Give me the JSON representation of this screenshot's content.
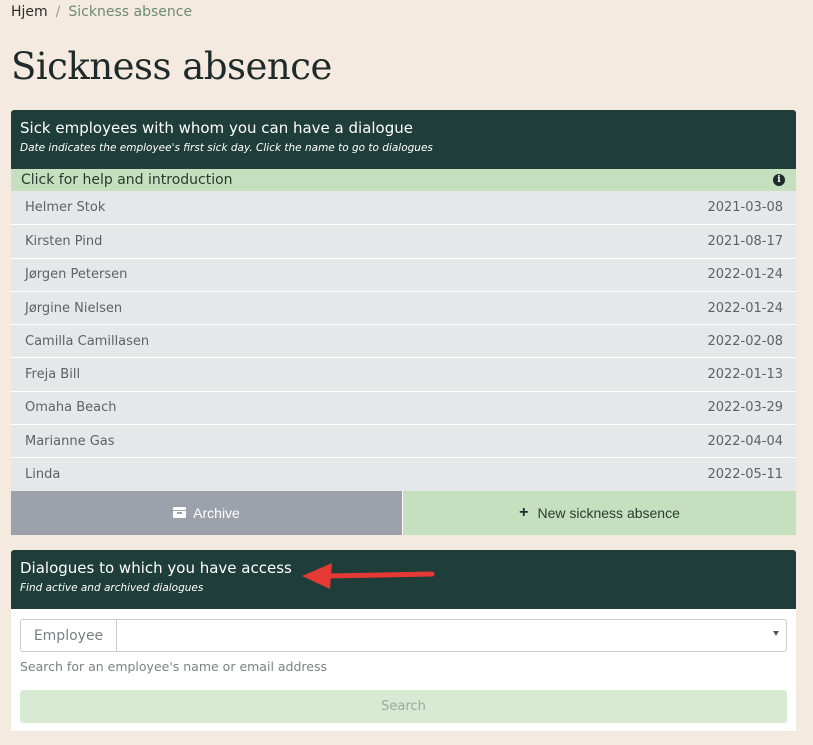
{
  "breadcrumb": {
    "home": "Hjem",
    "separator": "/",
    "current": "Sickness absence"
  },
  "page_title": "Sickness absence",
  "sick_card": {
    "title": "Sick employees with whom you can have a dialogue",
    "subtitle": "Date indicates the employee's first sick day. Click the name to go to dialogues",
    "help_label": "Click for help and introduction",
    "help_icon": "info-icon",
    "employees": [
      {
        "name": "Helmer Stok",
        "date": "2021-03-08"
      },
      {
        "name": "Kirsten Pind",
        "date": "2021-08-17"
      },
      {
        "name": "Jørgen Petersen",
        "date": "2022-01-24"
      },
      {
        "name": "Jørgine Nielsen",
        "date": "2022-01-24"
      },
      {
        "name": "Camilla Camillasen",
        "date": "2022-02-08"
      },
      {
        "name": "Freja Bill",
        "date": "2022-01-13"
      },
      {
        "name": "Omaha Beach",
        "date": "2022-03-29"
      },
      {
        "name": "Marianne Gas",
        "date": "2022-04-04"
      },
      {
        "name": "Linda",
        "date": "2022-05-11"
      }
    ],
    "archive_label": "Archive",
    "new_label": "New sickness absence"
  },
  "dialogue_card": {
    "title": "Dialogues to which you have access",
    "subtitle": "Find active and archived dialogues",
    "employee_label": "Employee",
    "select_value": "",
    "help_text": "Search for an employee's name or email address",
    "search_label": "Search"
  },
  "colors": {
    "page_bg": "#f4eadf",
    "header_bg": "#1f3d39",
    "accent_green": "#c4e0bf",
    "archive_gray": "#9ca1ab",
    "annotation_red": "#e53935"
  }
}
